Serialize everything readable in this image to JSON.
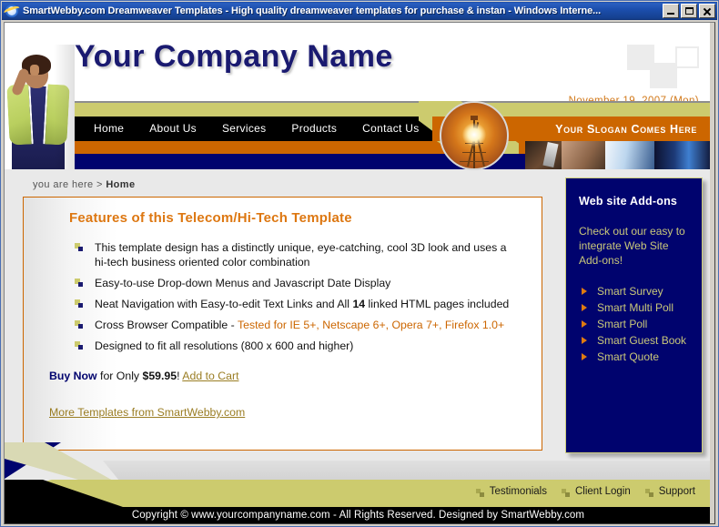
{
  "window": {
    "title": "SmartWebby.com Dreamweaver Templates - High quality dreamweaver templates for purchase & instan - Windows Interne...",
    "icon": "ie-browser-icon",
    "minimize_label": "Minimize",
    "maximize_label": "Maximize",
    "close_label": "Close"
  },
  "header": {
    "company_name": "Your Company Name",
    "date": "November 19, 2007 (Mon)",
    "slogan": "Your  Slogan Comes Here",
    "nav": [
      {
        "label": "Home"
      },
      {
        "label": "About Us"
      },
      {
        "label": "Services"
      },
      {
        "label": "Products"
      },
      {
        "label": "Contact Us"
      }
    ]
  },
  "breadcrumb": {
    "prefix": "you are  here > ",
    "current": "Home"
  },
  "main": {
    "title": "Features of this Telecom/Hi-Tech Template",
    "features": [
      {
        "text": "This template design has a distinctly unique, eye-catching, cool 3D look and uses a hi-tech business oriented color combination"
      },
      {
        "text": "Easy-to-use Drop-down Menus and Javascript Date Display"
      },
      {
        "text_before": "Neat Navigation with Easy-to-edit Text Links and All ",
        "bold": "14",
        "text_after": " linked HTML pages included"
      },
      {
        "text_before": "Cross Browser Compatible - ",
        "orange": "Tested for IE 5+, Netscape 6+, Opera 7+, Firefox 1.0+"
      },
      {
        "text": "Designed to fit all resolutions (800 x 600 and higher)"
      }
    ],
    "buy": {
      "buy_now": "Buy Now",
      "for_only": " for Only ",
      "price": "$59.95",
      "exclaim": "! ",
      "add_to_cart": "Add to Cart"
    },
    "more_link": "More Templates from SmartWebby.com"
  },
  "sidebar": {
    "title": "Web site Add-ons",
    "description": "Check out our easy to integrate Web Site Add-ons!",
    "items": [
      {
        "label": "Smart Survey"
      },
      {
        "label": "Smart Multi Poll"
      },
      {
        "label": "Smart Poll"
      },
      {
        "label": "Smart Guest Book"
      },
      {
        "label": "Smart Quote"
      }
    ]
  },
  "footer": {
    "links": [
      {
        "label": "Testimonials"
      },
      {
        "label": "Client Login"
      },
      {
        "label": "Support"
      }
    ],
    "copyright": "Copyright © www.yourcompanyname.com - All Rights Reserved. Designed by SmartWebby.com"
  },
  "colors": {
    "navy": "#00036e",
    "orange": "#cc6600",
    "khaki": "#cccb6e",
    "heading_orange": "#dd7711",
    "link_gold": "#9a7d23",
    "sidebar_text": "#c9c87a",
    "titlebar_blue": "#1b4ba8"
  }
}
